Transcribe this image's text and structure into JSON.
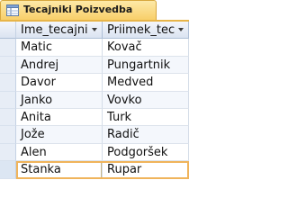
{
  "tab": {
    "title": "Tecajniki Poizvedba",
    "icon": "query-datasheet-icon"
  },
  "columns": [
    "Ime_tecajni",
    "Priimek_tec"
  ],
  "rows": [
    [
      "Matic",
      "Kovač"
    ],
    [
      "Andrej",
      "Pungartnik"
    ],
    [
      "Davor",
      "Medved"
    ],
    [
      "Janko",
      "Vovko"
    ],
    [
      "Anita",
      "Turk"
    ],
    [
      "Jože",
      "Radič"
    ],
    [
      "Alen",
      "Podgoršek"
    ],
    [
      "Stanka",
      "Rupar"
    ]
  ],
  "colors": {
    "tab": "#f8cf6a",
    "selection": "#f0b45b",
    "header": "#dbe4f1"
  }
}
